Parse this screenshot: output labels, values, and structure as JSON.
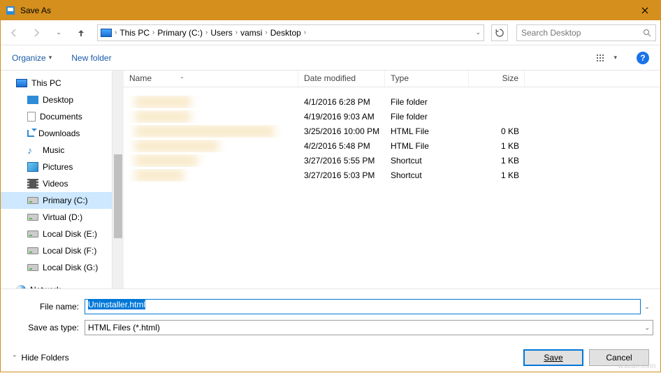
{
  "title": "Save As",
  "breadcrumbs": [
    "This PC",
    "Primary (C:)",
    "Users",
    "vamsi",
    "Desktop"
  ],
  "search_placeholder": "Search Desktop",
  "toolbar": {
    "organize": "Organize",
    "newfolder": "New folder"
  },
  "tree": {
    "root": "This PC",
    "items": [
      "Desktop",
      "Documents",
      "Downloads",
      "Music",
      "Pictures",
      "Videos",
      "Primary (C:)",
      "Virtual (D:)",
      "Local Disk (E:)",
      "Local Disk (F:)",
      "Local Disk (G:)"
    ],
    "network": "Network"
  },
  "headers": {
    "name": "Name",
    "date": "Date modified",
    "type": "Type",
    "size": "Size"
  },
  "rows": [
    {
      "date": "4/1/2016 6:28 PM",
      "type": "File folder",
      "size": ""
    },
    {
      "date": "4/19/2016 9:03 AM",
      "type": "File folder",
      "size": ""
    },
    {
      "date": "3/25/2016 10:00 PM",
      "type": "HTML File",
      "size": "0 KB"
    },
    {
      "date": "4/2/2016 5:48 PM",
      "type": "HTML File",
      "size": "1 KB"
    },
    {
      "date": "3/27/2016 5:55 PM",
      "type": "Shortcut",
      "size": "1 KB"
    },
    {
      "date": "3/27/2016 5:03 PM",
      "type": "Shortcut",
      "size": "1 KB"
    }
  ],
  "labels": {
    "filename": "File name:",
    "saveastype": "Save as type:",
    "hidefolders": "Hide Folders",
    "save": "Save",
    "cancel": "Cancel"
  },
  "fields": {
    "filename": "Uninstaller.html",
    "saveastype": "HTML Files (*.html)"
  },
  "watermark": "wsxdn.com"
}
